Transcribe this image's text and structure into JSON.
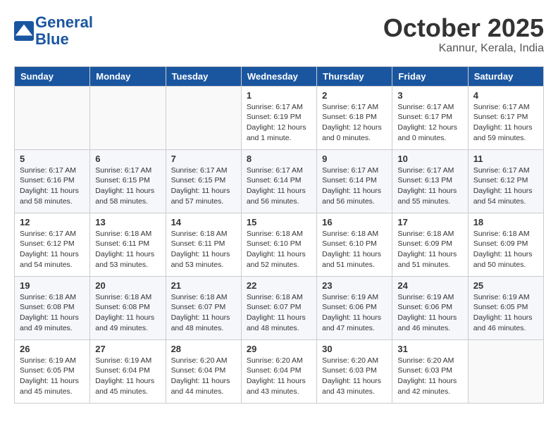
{
  "header": {
    "logo_line1": "General",
    "logo_line2": "Blue",
    "month": "October 2025",
    "location": "Kannur, Kerala, India"
  },
  "weekdays": [
    "Sunday",
    "Monday",
    "Tuesday",
    "Wednesday",
    "Thursday",
    "Friday",
    "Saturday"
  ],
  "weeks": [
    [
      {
        "day": "",
        "sunrise": "",
        "sunset": "",
        "daylight": ""
      },
      {
        "day": "",
        "sunrise": "",
        "sunset": "",
        "daylight": ""
      },
      {
        "day": "",
        "sunrise": "",
        "sunset": "",
        "daylight": ""
      },
      {
        "day": "1",
        "sunrise": "Sunrise: 6:17 AM",
        "sunset": "Sunset: 6:19 PM",
        "daylight": "Daylight: 12 hours and 1 minute."
      },
      {
        "day": "2",
        "sunrise": "Sunrise: 6:17 AM",
        "sunset": "Sunset: 6:18 PM",
        "daylight": "Daylight: 12 hours and 0 minutes."
      },
      {
        "day": "3",
        "sunrise": "Sunrise: 6:17 AM",
        "sunset": "Sunset: 6:17 PM",
        "daylight": "Daylight: 12 hours and 0 minutes."
      },
      {
        "day": "4",
        "sunrise": "Sunrise: 6:17 AM",
        "sunset": "Sunset: 6:17 PM",
        "daylight": "Daylight: 11 hours and 59 minutes."
      }
    ],
    [
      {
        "day": "5",
        "sunrise": "Sunrise: 6:17 AM",
        "sunset": "Sunset: 6:16 PM",
        "daylight": "Daylight: 11 hours and 58 minutes."
      },
      {
        "day": "6",
        "sunrise": "Sunrise: 6:17 AM",
        "sunset": "Sunset: 6:15 PM",
        "daylight": "Daylight: 11 hours and 58 minutes."
      },
      {
        "day": "7",
        "sunrise": "Sunrise: 6:17 AM",
        "sunset": "Sunset: 6:15 PM",
        "daylight": "Daylight: 11 hours and 57 minutes."
      },
      {
        "day": "8",
        "sunrise": "Sunrise: 6:17 AM",
        "sunset": "Sunset: 6:14 PM",
        "daylight": "Daylight: 11 hours and 56 minutes."
      },
      {
        "day": "9",
        "sunrise": "Sunrise: 6:17 AM",
        "sunset": "Sunset: 6:14 PM",
        "daylight": "Daylight: 11 hours and 56 minutes."
      },
      {
        "day": "10",
        "sunrise": "Sunrise: 6:17 AM",
        "sunset": "Sunset: 6:13 PM",
        "daylight": "Daylight: 11 hours and 55 minutes."
      },
      {
        "day": "11",
        "sunrise": "Sunrise: 6:17 AM",
        "sunset": "Sunset: 6:12 PM",
        "daylight": "Daylight: 11 hours and 54 minutes."
      }
    ],
    [
      {
        "day": "12",
        "sunrise": "Sunrise: 6:17 AM",
        "sunset": "Sunset: 6:12 PM",
        "daylight": "Daylight: 11 hours and 54 minutes."
      },
      {
        "day": "13",
        "sunrise": "Sunrise: 6:18 AM",
        "sunset": "Sunset: 6:11 PM",
        "daylight": "Daylight: 11 hours and 53 minutes."
      },
      {
        "day": "14",
        "sunrise": "Sunrise: 6:18 AM",
        "sunset": "Sunset: 6:11 PM",
        "daylight": "Daylight: 11 hours and 53 minutes."
      },
      {
        "day": "15",
        "sunrise": "Sunrise: 6:18 AM",
        "sunset": "Sunset: 6:10 PM",
        "daylight": "Daylight: 11 hours and 52 minutes."
      },
      {
        "day": "16",
        "sunrise": "Sunrise: 6:18 AM",
        "sunset": "Sunset: 6:10 PM",
        "daylight": "Daylight: 11 hours and 51 minutes."
      },
      {
        "day": "17",
        "sunrise": "Sunrise: 6:18 AM",
        "sunset": "Sunset: 6:09 PM",
        "daylight": "Daylight: 11 hours and 51 minutes."
      },
      {
        "day": "18",
        "sunrise": "Sunrise: 6:18 AM",
        "sunset": "Sunset: 6:09 PM",
        "daylight": "Daylight: 11 hours and 50 minutes."
      }
    ],
    [
      {
        "day": "19",
        "sunrise": "Sunrise: 6:18 AM",
        "sunset": "Sunset: 6:08 PM",
        "daylight": "Daylight: 11 hours and 49 minutes."
      },
      {
        "day": "20",
        "sunrise": "Sunrise: 6:18 AM",
        "sunset": "Sunset: 6:08 PM",
        "daylight": "Daylight: 11 hours and 49 minutes."
      },
      {
        "day": "21",
        "sunrise": "Sunrise: 6:18 AM",
        "sunset": "Sunset: 6:07 PM",
        "daylight": "Daylight: 11 hours and 48 minutes."
      },
      {
        "day": "22",
        "sunrise": "Sunrise: 6:18 AM",
        "sunset": "Sunset: 6:07 PM",
        "daylight": "Daylight: 11 hours and 48 minutes."
      },
      {
        "day": "23",
        "sunrise": "Sunrise: 6:19 AM",
        "sunset": "Sunset: 6:06 PM",
        "daylight": "Daylight: 11 hours and 47 minutes."
      },
      {
        "day": "24",
        "sunrise": "Sunrise: 6:19 AM",
        "sunset": "Sunset: 6:06 PM",
        "daylight": "Daylight: 11 hours and 46 minutes."
      },
      {
        "day": "25",
        "sunrise": "Sunrise: 6:19 AM",
        "sunset": "Sunset: 6:05 PM",
        "daylight": "Daylight: 11 hours and 46 minutes."
      }
    ],
    [
      {
        "day": "26",
        "sunrise": "Sunrise: 6:19 AM",
        "sunset": "Sunset: 6:05 PM",
        "daylight": "Daylight: 11 hours and 45 minutes."
      },
      {
        "day": "27",
        "sunrise": "Sunrise: 6:19 AM",
        "sunset": "Sunset: 6:04 PM",
        "daylight": "Daylight: 11 hours and 45 minutes."
      },
      {
        "day": "28",
        "sunrise": "Sunrise: 6:20 AM",
        "sunset": "Sunset: 6:04 PM",
        "daylight": "Daylight: 11 hours and 44 minutes."
      },
      {
        "day": "29",
        "sunrise": "Sunrise: 6:20 AM",
        "sunset": "Sunset: 6:04 PM",
        "daylight": "Daylight: 11 hours and 43 minutes."
      },
      {
        "day": "30",
        "sunrise": "Sunrise: 6:20 AM",
        "sunset": "Sunset: 6:03 PM",
        "daylight": "Daylight: 11 hours and 43 minutes."
      },
      {
        "day": "31",
        "sunrise": "Sunrise: 6:20 AM",
        "sunset": "Sunset: 6:03 PM",
        "daylight": "Daylight: 11 hours and 42 minutes."
      },
      {
        "day": "",
        "sunrise": "",
        "sunset": "",
        "daylight": ""
      }
    ]
  ]
}
